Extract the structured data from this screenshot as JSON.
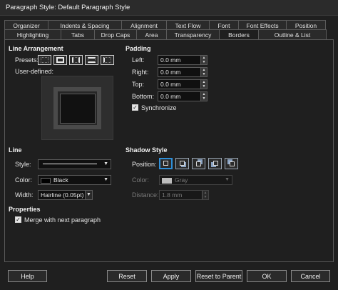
{
  "window": {
    "title": "Paragraph Style: Default Paragraph Style"
  },
  "tabs": {
    "row1": [
      "Organizer",
      "Indents & Spacing",
      "Alignment",
      "Text Flow",
      "Font",
      "Font Effects",
      "Position"
    ],
    "row2": [
      "Highlighting",
      "Tabs",
      "Drop Caps",
      "Area",
      "Transparency",
      "Borders",
      "Outline & List"
    ],
    "active": "Borders"
  },
  "line_arrangement": {
    "heading": "Line Arrangement",
    "presets_label": "Presets:",
    "user_defined_label": "User-defined:",
    "preset_icons": [
      "border-none-icon",
      "border-all-icon",
      "border-left-right-icon",
      "border-top-bottom-icon",
      "border-left-icon"
    ]
  },
  "padding": {
    "heading": "Padding",
    "left_label": "Left:",
    "left_value": "0.0 mm",
    "right_label": "Right:",
    "right_value": "0.0 mm",
    "top_label": "Top:",
    "top_value": "0.0 mm",
    "bottom_label": "Bottom:",
    "bottom_value": "0.0 mm",
    "synchronize_label": "Synchronize",
    "synchronize_checked": true
  },
  "line": {
    "heading": "Line",
    "style_label": "Style:",
    "color_label": "Color:",
    "color_value": "Black",
    "color_hex": "#000000",
    "width_label": "Width:",
    "width_value": "Hairline (0.05pt)"
  },
  "shadow": {
    "heading": "Shadow Style",
    "position_label": "Position:",
    "position_icons": [
      "shadow-none-icon",
      "shadow-bottom-right-icon",
      "shadow-top-right-icon",
      "shadow-bottom-left-icon",
      "shadow-top-left-icon"
    ],
    "color_label": "Color:",
    "color_value": "Gray",
    "color_hex": "#bdbdbd",
    "distance_label": "Distance:",
    "distance_value": "1.8 mm"
  },
  "properties": {
    "heading": "Properties",
    "merge_label": "Merge with next paragraph",
    "merge_checked": true
  },
  "buttons": {
    "help": "Help",
    "reset": "Reset",
    "apply": "Apply",
    "reset_to_parent": "Reset to Parent",
    "ok": "OK",
    "cancel": "Cancel"
  },
  "colors": {
    "accent": "#2f8fd8",
    "background": "#1f1f1f"
  }
}
